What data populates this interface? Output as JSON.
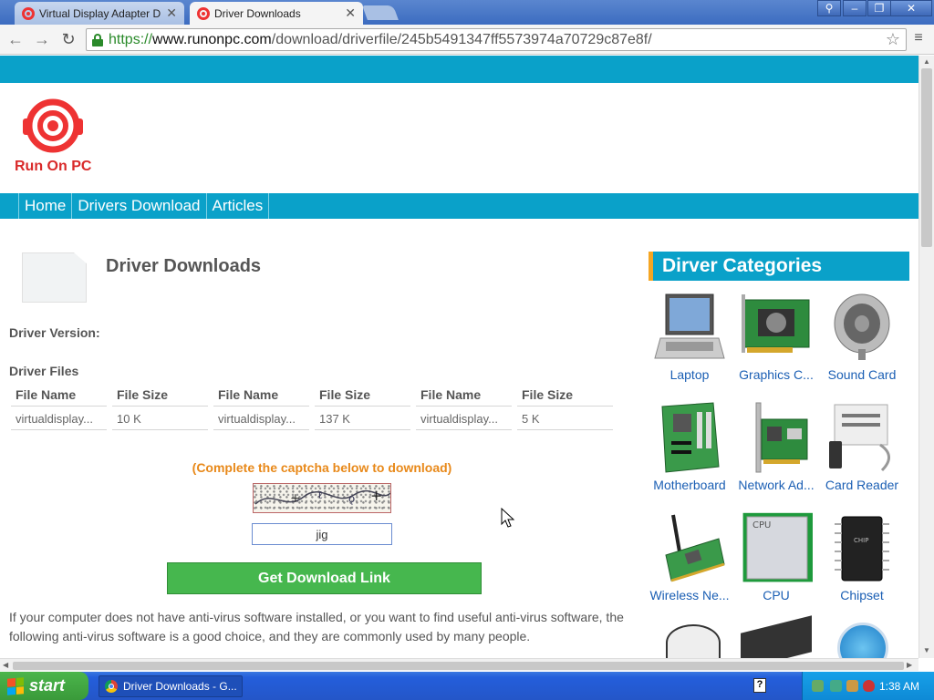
{
  "browser": {
    "tabs": [
      {
        "label": "Virtual Display Adapter Driver",
        "active": false
      },
      {
        "label": "Driver Downloads",
        "active": true
      }
    ],
    "url": {
      "scheme": "https://",
      "host": "www.runonpc.com",
      "path": "/download/driverfile/245b5491347ff5573974a70729c87e8f/"
    }
  },
  "site": {
    "logo_text": "Run On PC",
    "brand_color": "#d92a2a",
    "accent_color": "#0aa1c9",
    "nav": [
      "Home",
      "Drivers Download",
      "Articles"
    ]
  },
  "main": {
    "title": "Driver Downloads",
    "driver_version_label": "Driver Version:",
    "driver_files_label": "Driver Files",
    "files_table": {
      "headers": [
        "File Name",
        "File Size",
        "File Name",
        "File Size",
        "File Name",
        "File Size"
      ],
      "row": [
        "virtualdisplay...",
        "10 K",
        "virtualdisplay...",
        "137 K",
        "virtualdisplay...",
        "5 K"
      ]
    },
    "captcha_prompt": "(Complete the captcha below to download)",
    "captcha_value": "jig",
    "download_button": "Get Download Link",
    "antivirus_note": "If your computer does not have anti-virus software installed, or you want to find useful anti-virus software, the following anti-virus software is a good choice, and they are commonly used by many people."
  },
  "categories": {
    "title": "Dirver Categories",
    "items": [
      {
        "label": "Laptop",
        "icon": "laptop-icon"
      },
      {
        "label": "Graphics C...",
        "icon": "graphics-card-icon"
      },
      {
        "label": "Sound Card",
        "icon": "speaker-icon"
      },
      {
        "label": "Motherboard",
        "icon": "motherboard-icon"
      },
      {
        "label": "Network Ad...",
        "icon": "network-adapter-icon"
      },
      {
        "label": "Card Reader",
        "icon": "card-reader-icon"
      },
      {
        "label": "Wireless Ne...",
        "icon": "wireless-card-icon"
      },
      {
        "label": "CPU",
        "icon": "cpu-icon"
      },
      {
        "label": "Chipset",
        "icon": "chipset-icon"
      }
    ],
    "cpu_chip_text": "CPU",
    "chipset_chip_text": "CHIP"
  },
  "taskbar": {
    "start_label": "start",
    "task_label": "Driver Downloads - G...",
    "clock": "1:38 AM"
  }
}
